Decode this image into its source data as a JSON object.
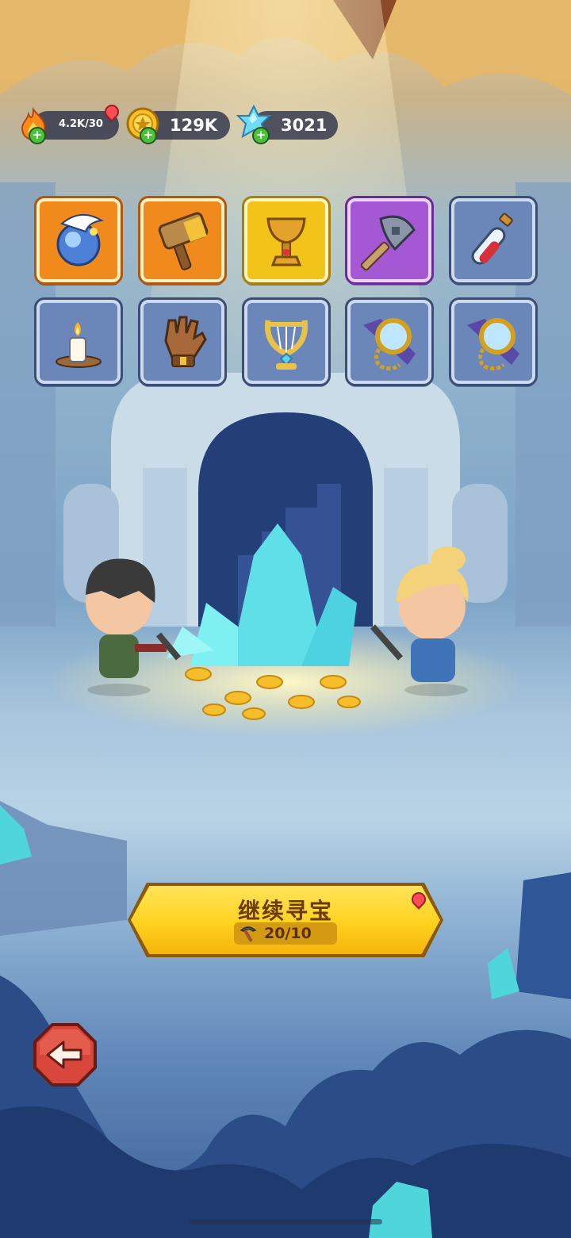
{
  "hud": {
    "energy": {
      "value": "4.2K/30",
      "icon": "flame-icon",
      "has_notification": true
    },
    "coins": {
      "value": "129K",
      "icon": "gold-coin-icon"
    },
    "gems": {
      "value": "3021",
      "icon": "blue-crystal-icon"
    }
  },
  "items": [
    {
      "name": "spirit-orb",
      "rarity": "orange"
    },
    {
      "name": "stone-hammer",
      "rarity": "orange"
    },
    {
      "name": "golden-chalice",
      "rarity": "gold"
    },
    {
      "name": "battle-axe",
      "rarity": "purple"
    },
    {
      "name": "red-potion",
      "rarity": "blue"
    },
    {
      "name": "candle",
      "rarity": "blue"
    },
    {
      "name": "leather-glove",
      "rarity": "blue"
    },
    {
      "name": "golden-lyre",
      "rarity": "blue"
    },
    {
      "name": "magnifying-glass",
      "rarity": "blue"
    },
    {
      "name": "magnifying-glass",
      "rarity": "blue"
    }
  ],
  "continue_button": {
    "label": "继续寻宝",
    "cost": "20/10",
    "cost_icon": "pickaxe-icon",
    "has_notification": true
  },
  "back_button": {
    "icon": "back-arrow-icon"
  },
  "colors": {
    "rarity_orange": "#f08a1c",
    "rarity_gold": "#f2c318",
    "rarity_purple": "#a458d4",
    "rarity_blue": "#6b86b8",
    "button_yellow": "#ffd21f",
    "back_red": "#d8473b"
  }
}
